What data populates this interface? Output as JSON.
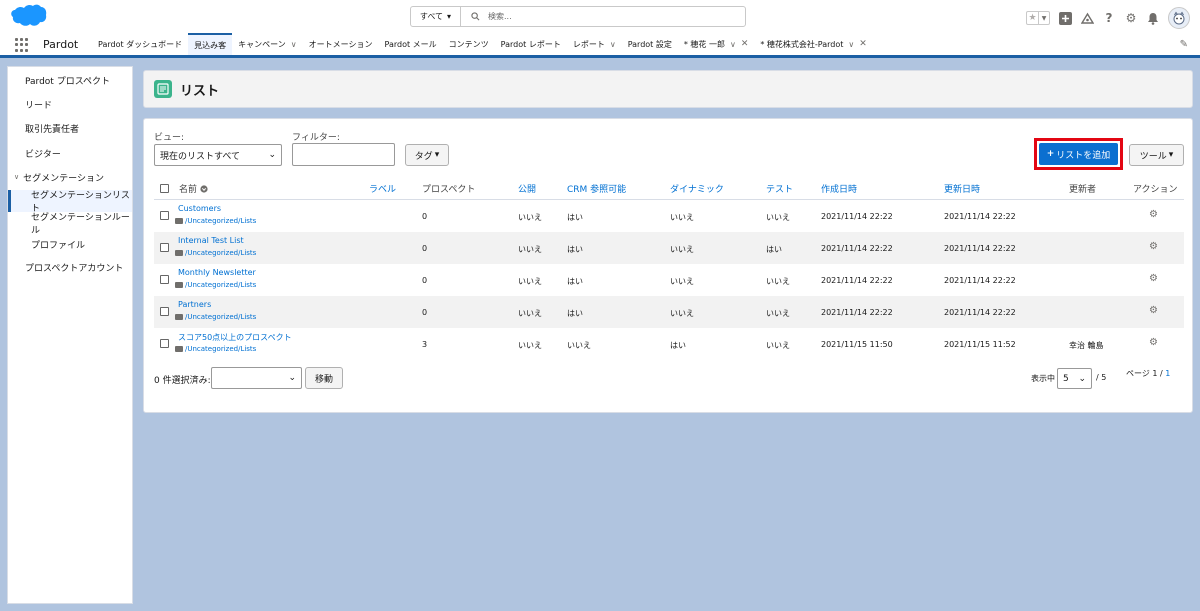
{
  "header": {
    "search_scope": "すべて",
    "search_placeholder": "検索..."
  },
  "nav": {
    "app_name": "Pardot",
    "tabs": [
      {
        "label": "Pardot ダッシュボード",
        "active": false
      },
      {
        "label": "見込み客",
        "active": true
      },
      {
        "label": "キャンペーン",
        "active": false,
        "chevron": true
      },
      {
        "label": "オートメーション",
        "active": false
      },
      {
        "label": "Pardot メール",
        "active": false
      },
      {
        "label": "コンテンツ",
        "active": false
      },
      {
        "label": "Pardot レポート",
        "active": false
      },
      {
        "label": "レポート",
        "active": false,
        "chevron": true
      },
      {
        "label": "Pardot 設定",
        "active": false
      },
      {
        "label": "* 穂花 一郎",
        "active": false,
        "chevron": true,
        "closable": true
      },
      {
        "label": "* 穂花株式会社-Pardot",
        "active": false,
        "chevron": true,
        "closable": true
      }
    ]
  },
  "sidebar": {
    "items": [
      {
        "label": "Pardot プロスペクト"
      },
      {
        "label": "リード"
      },
      {
        "label": "取引先責任者"
      },
      {
        "label": "ビジター"
      },
      {
        "label": "セグメンテーション"
      },
      {
        "label": "セグメンテーションリスト"
      },
      {
        "label": "セグメンテーションルール"
      },
      {
        "label": "プロファイル"
      },
      {
        "label": "プロスペクトアカウント"
      }
    ]
  },
  "page": {
    "title": "リスト"
  },
  "toolbar": {
    "view_label": "ビュー:",
    "view_value": "現在のリストすべて",
    "filter_label": "フィルター:",
    "filter_value": "",
    "tag_button": "タグ",
    "add_button": "リストを追加",
    "tools_button": "ツール"
  },
  "table": {
    "headers": [
      "名前",
      "ラベル",
      "プロスペクト",
      "公開",
      "CRM 参照可能",
      "ダイナミック",
      "テスト",
      "作成日時",
      "更新日時",
      "更新者",
      "アクション"
    ],
    "rows": [
      {
        "name": "Customers",
        "path": "/Uncategorized/Lists",
        "label": "",
        "prospects": "0",
        "public": "いいえ",
        "crm": "はい",
        "dynamic": "いいえ",
        "test": "いいえ",
        "created": "2021/11/14 22:22",
        "updated": "2021/11/14 22:22",
        "updated_by": ""
      },
      {
        "name": "Internal Test List",
        "path": "/Uncategorized/Lists",
        "label": "",
        "prospects": "0",
        "public": "いいえ",
        "crm": "はい",
        "dynamic": "いいえ",
        "test": "はい",
        "created": "2021/11/14 22:22",
        "updated": "2021/11/14 22:22",
        "updated_by": ""
      },
      {
        "name": "Monthly Newsletter",
        "path": "/Uncategorized/Lists",
        "label": "",
        "prospects": "0",
        "public": "いいえ",
        "crm": "はい",
        "dynamic": "いいえ",
        "test": "いいえ",
        "created": "2021/11/14 22:22",
        "updated": "2021/11/14 22:22",
        "updated_by": ""
      },
      {
        "name": "Partners",
        "path": "/Uncategorized/Lists",
        "label": "",
        "prospects": "0",
        "public": "いいえ",
        "crm": "はい",
        "dynamic": "いいえ",
        "test": "いいえ",
        "created": "2021/11/14 22:22",
        "updated": "2021/11/14 22:22",
        "updated_by": ""
      },
      {
        "name": "スコア50点以上のプロスペクト",
        "path": "/Uncategorized/Lists",
        "label": "",
        "prospects": "3",
        "public": "いいえ",
        "crm": "いいえ",
        "dynamic": "はい",
        "test": "いいえ",
        "created": "2021/11/15 11:50",
        "updated": "2021/11/15 11:52",
        "updated_by": "幸治 輪島"
      }
    ]
  },
  "footer": {
    "selected_count": "0 件選択済み:",
    "move_button": "移動",
    "per_page_label": "表示中",
    "per_page_value": "5",
    "per_page_total": "/ 5",
    "page_label": "ページ 1 /",
    "page_total": "1"
  }
}
